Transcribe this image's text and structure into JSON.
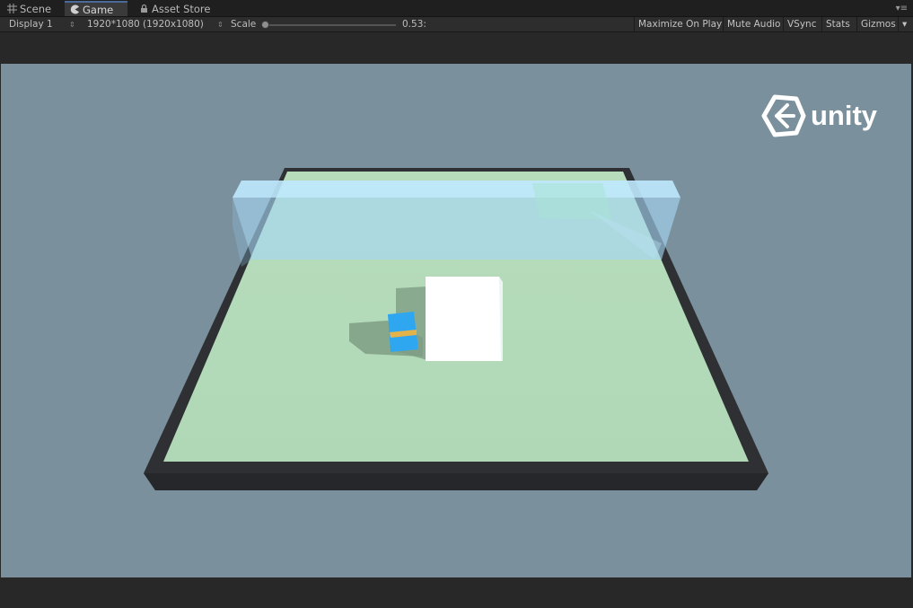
{
  "tabs": [
    {
      "label": "Scene",
      "icon": "grid-icon"
    },
    {
      "label": "Game",
      "icon": "pacman-icon"
    },
    {
      "label": "Asset Store",
      "icon": "lock-icon"
    }
  ],
  "tab_menu_glyph": "▾≡",
  "toolbar": {
    "display": "Display 1",
    "resolution": "1920*1080 (1920x1080)",
    "scale_label": "Scale",
    "scale_value": "0.53:",
    "maximize_on_play": "Maximize On Play",
    "mute_audio": "Mute Audio",
    "vsync": "VSync",
    "stats": "Stats",
    "gizmos": "Gizmos",
    "updown_glyph": "⇕",
    "dropdown_glyph": "▾"
  },
  "watermark": {
    "text": "unity"
  },
  "colors": {
    "viewport_bg": "#7a909c",
    "floor": "#b3dbb9",
    "border": "#34363a",
    "water": "#a8d8f4",
    "blue_cube": "#2fa7f0",
    "stripe": "#e3b24a",
    "white_cube": "#ffffff"
  }
}
